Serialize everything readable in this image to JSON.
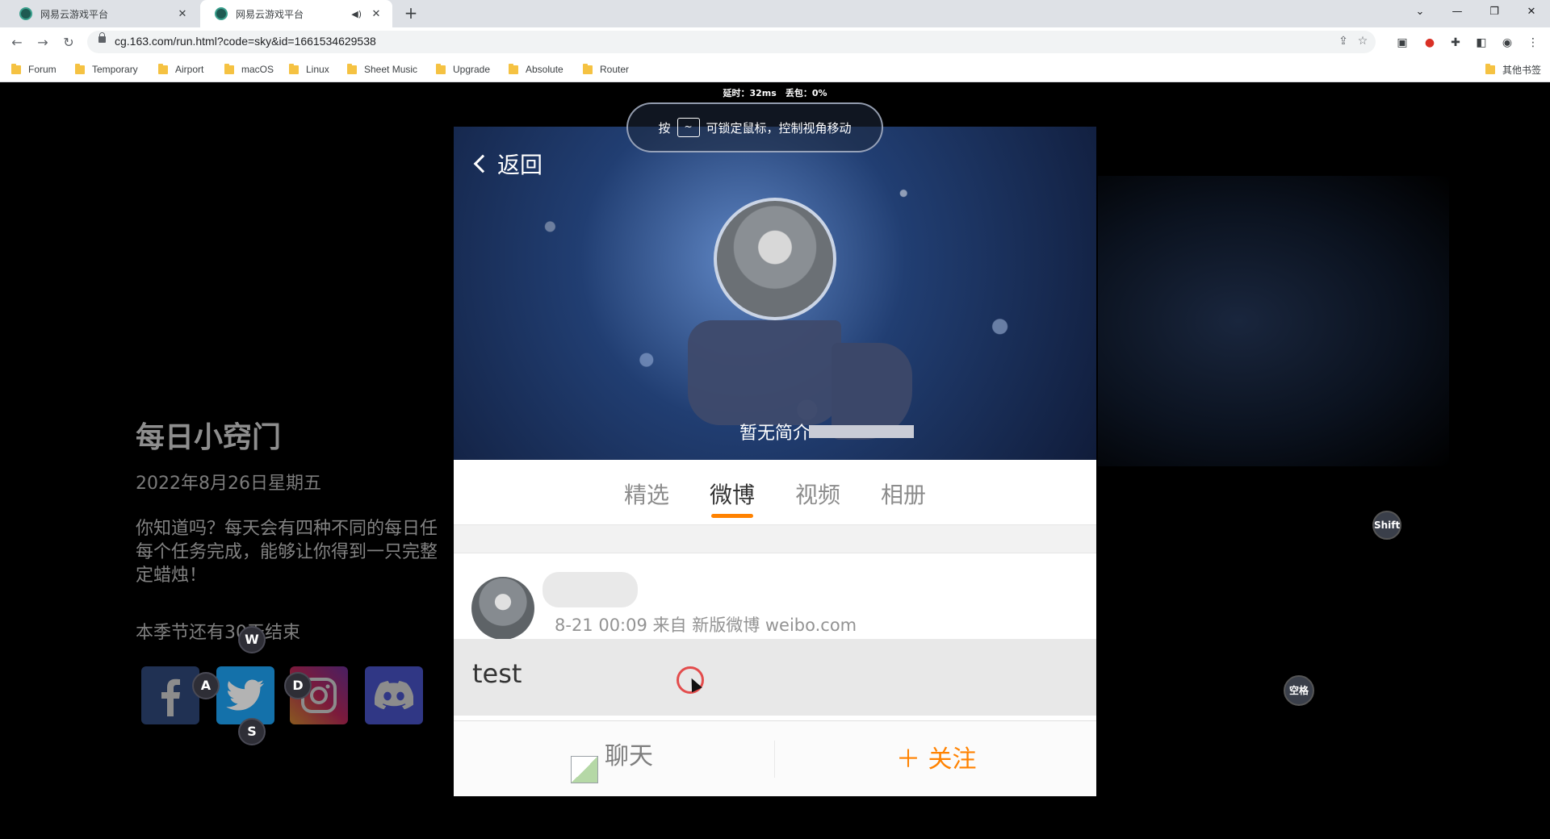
{
  "browser": {
    "tabs": [
      {
        "title": "网易云游戏平台"
      },
      {
        "title": "网易云游戏平台"
      }
    ],
    "url": "cg.163.com/run.html?code=sky&id=1661534629538",
    "bookmarks": [
      "Forum",
      "Temporary",
      "Airport",
      "macOS",
      "Linux",
      "Sheet Music",
      "Upgrade",
      "Absolute",
      "Router"
    ],
    "other_bookmarks": "其他书签"
  },
  "stream": {
    "netstat": "延时：32ms　丢包：0%",
    "lock_hint_prefix": "按",
    "lock_hint_suffix": "可锁定鼠标，控制视角移动",
    "lock_hint_key": "~"
  },
  "game_left": {
    "title": "每日小窍门",
    "date": "2022年8月26日星期五",
    "desc": "你知道吗？每天会有四种不同的每日任每个任务完成，能够让你得到一只完整定蜡烛！",
    "season": "本季节还有30天结束",
    "keys": [
      "W",
      "A",
      "S",
      "D"
    ]
  },
  "profile": {
    "back_label": "返回",
    "bio": "暂无简介",
    "tabs": [
      "精选",
      "微博",
      "视频",
      "相册"
    ],
    "active_tab": 1,
    "post_meta": "8-21 00:09 来自 新版微博 weibo.com",
    "post_text": "test",
    "chat_label": "聊天",
    "follow_label": "＋ 关注"
  },
  "overlay_keys": {
    "shift": "Shift",
    "space": "空格"
  },
  "colors": {
    "accent": "#ff8200",
    "tabstrip": "#dee1e6"
  }
}
